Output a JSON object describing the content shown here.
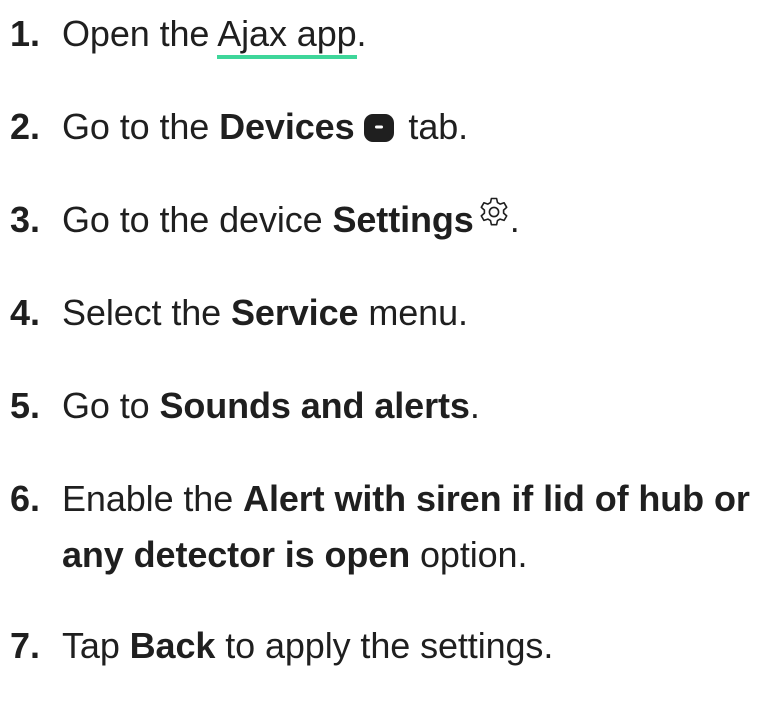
{
  "steps": [
    {
      "num": "1.",
      "before": "Open the ",
      "link": "Ajax app",
      "after": "."
    },
    {
      "num": "2.",
      "before": "Go to the ",
      "bold": "Devices",
      "icon": "devices-icon",
      "after": " tab."
    },
    {
      "num": "3.",
      "before": "Go to the device ",
      "bold": "Settings",
      "icon": "gear-icon",
      "after": "."
    },
    {
      "num": "4.",
      "before": "Select the ",
      "bold": "Service",
      "after": " menu."
    },
    {
      "num": "5.",
      "before": "Go to ",
      "bold": "Sounds and alerts",
      "after": "."
    },
    {
      "num": "6.",
      "before": "Enable the ",
      "bold_line1": "Alert with siren if lid of hub or",
      "bold_line2": "any detector is open",
      "after": " option."
    },
    {
      "num": "7.",
      "before": "Tap ",
      "bold": "Back",
      "after": " to apply the settings."
    }
  ],
  "colors": {
    "text": "#1f1f1f",
    "link_underline": "#3ed69a"
  }
}
